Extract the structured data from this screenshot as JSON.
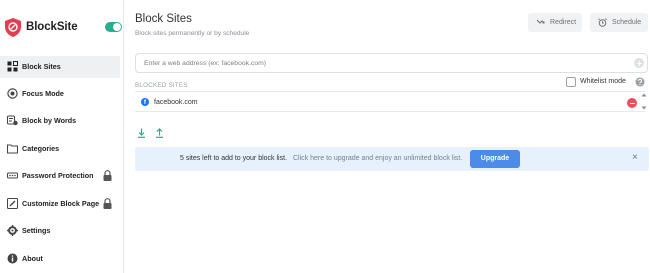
{
  "brand": {
    "name": "BlockSite",
    "enabled": true,
    "colors": {
      "brand_red": "#e53d4d",
      "toggle_green": "#27ae8c",
      "accent_blue": "#4c8be8"
    }
  },
  "sidebar": {
    "items": [
      {
        "label": "Block Sites",
        "icon": "block-sites-icon",
        "active": true,
        "locked": false
      },
      {
        "label": "Focus Mode",
        "icon": "focus-mode-icon",
        "active": false,
        "locked": false
      },
      {
        "label": "Block by Words",
        "icon": "block-by-words-icon",
        "active": false,
        "locked": false
      },
      {
        "label": "Categories",
        "icon": "categories-icon",
        "active": false,
        "locked": false
      },
      {
        "label": "Password Protection",
        "icon": "password-icon",
        "active": false,
        "locked": true
      },
      {
        "label": "Customize Block Page",
        "icon": "customize-icon",
        "active": false,
        "locked": true
      },
      {
        "label": "Settings",
        "icon": "gear-icon",
        "active": false,
        "locked": false
      },
      {
        "label": "About",
        "icon": "info-icon",
        "active": false,
        "locked": false
      }
    ]
  },
  "header": {
    "title": "Block Sites",
    "subtitle": "Block sites permanently or by schedule",
    "redirect_label": "Redirect",
    "schedule_label": "Schedule"
  },
  "input": {
    "placeholder": "Enter a web address (ex: facebook.com)",
    "value": ""
  },
  "blocked": {
    "section_label": "BLOCKED SITES",
    "whitelist_label": "Whitelist mode",
    "whitelist_checked": false,
    "sites": [
      {
        "name": "facebook.com",
        "icon": "facebook-icon"
      }
    ]
  },
  "banner": {
    "count_text": "5 sites left to add to your block list.",
    "cta_text": "Click here to upgrade and enjoy an unlimited block list.",
    "upgrade_label": "Upgrade",
    "close_glyph": "×"
  }
}
